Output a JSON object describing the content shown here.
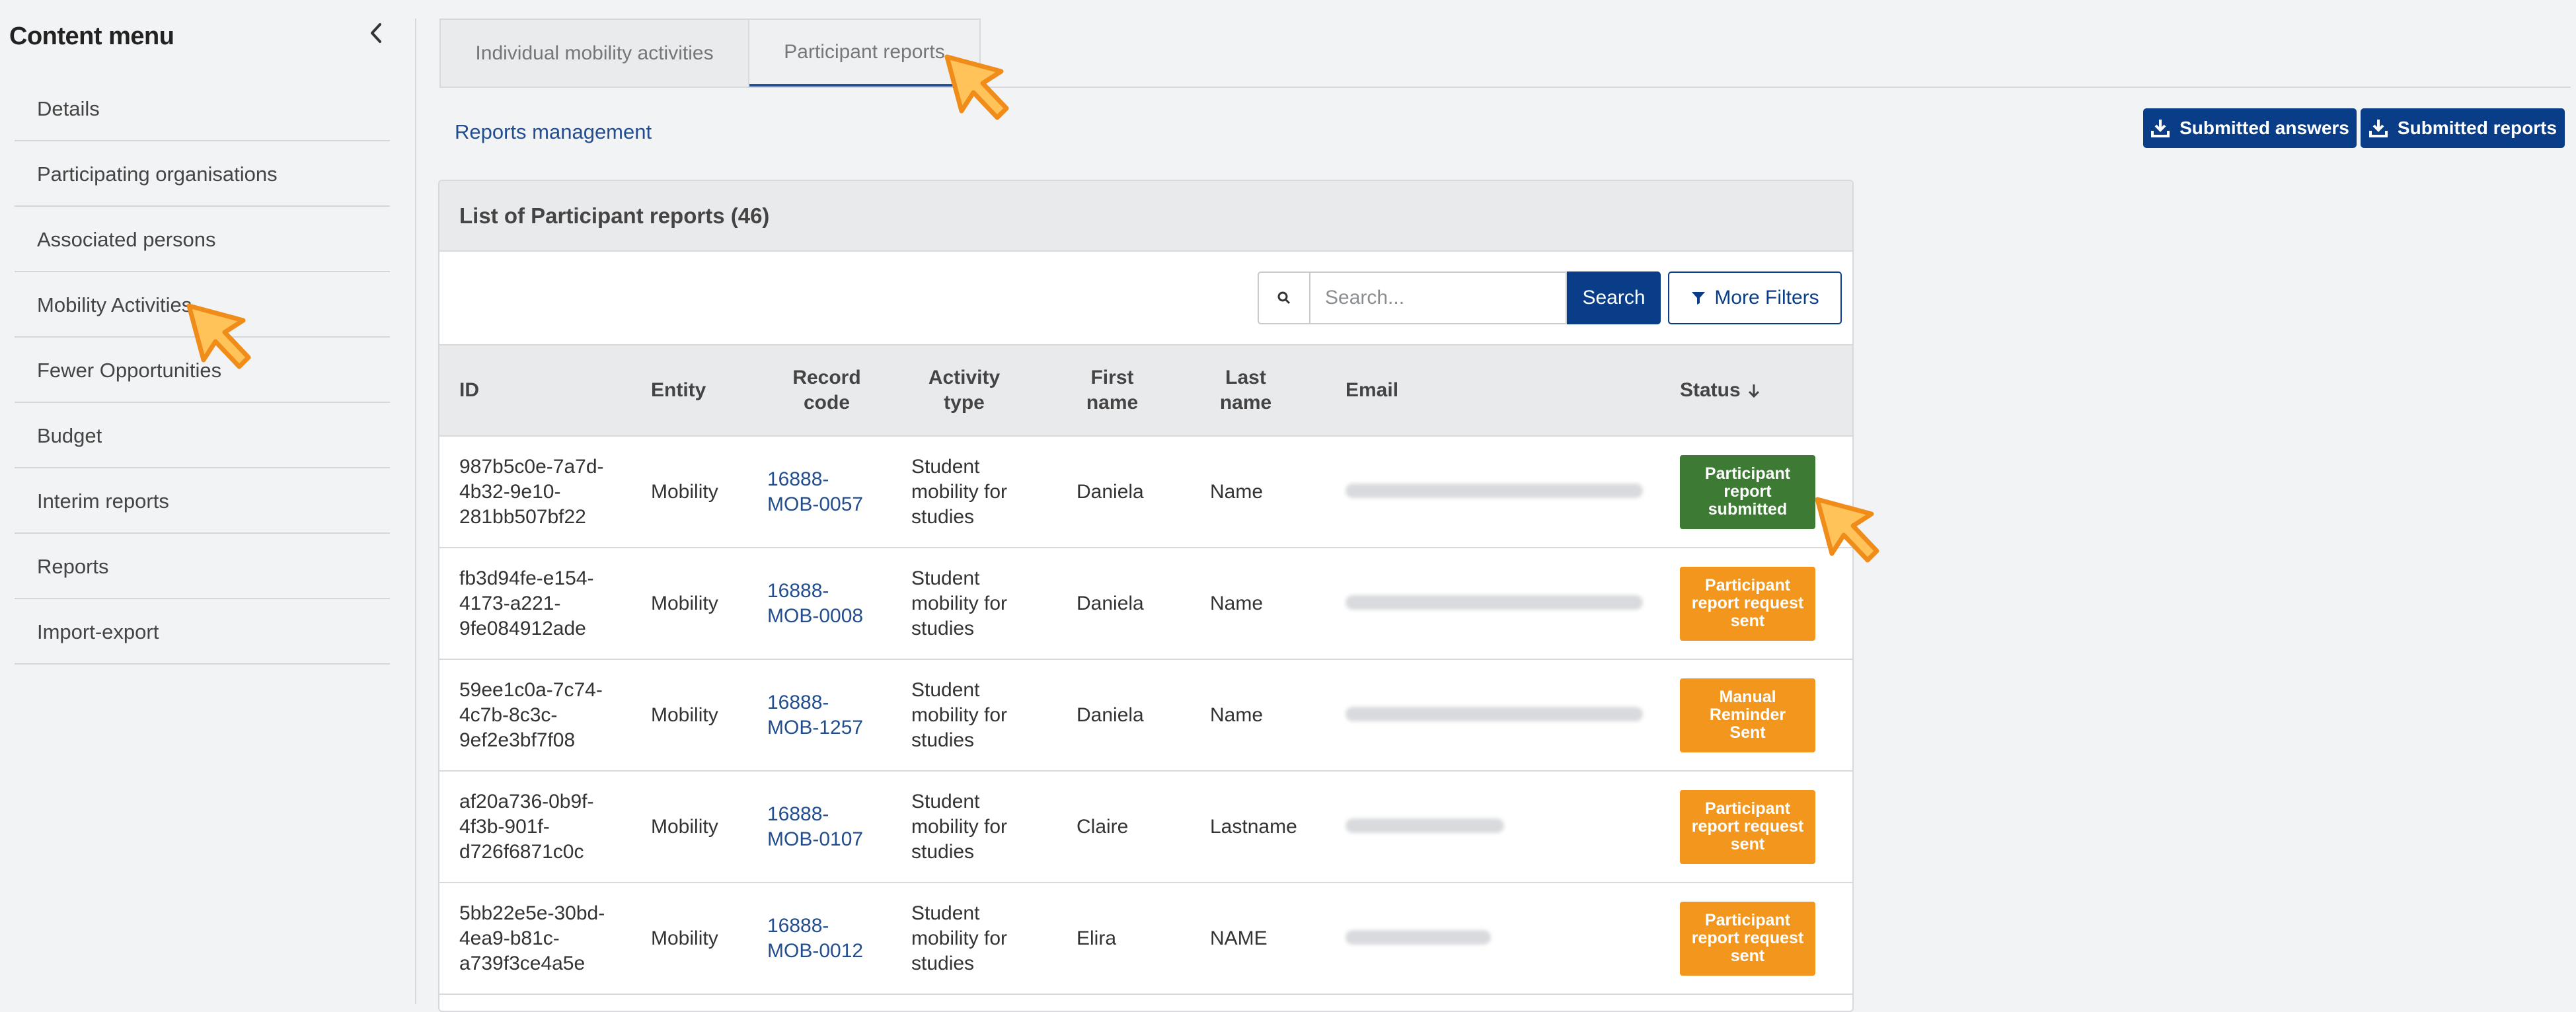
{
  "sidebar": {
    "title": "Content menu",
    "items": [
      {
        "label": "Details"
      },
      {
        "label": "Participating organisations"
      },
      {
        "label": "Associated persons"
      },
      {
        "label": "Mobility Activities"
      },
      {
        "label": "Fewer Opportunities"
      },
      {
        "label": "Budget"
      },
      {
        "label": "Interim reports"
      },
      {
        "label": "Reports"
      },
      {
        "label": "Import-export"
      }
    ]
  },
  "tabs": [
    {
      "label": "Individual mobility activities"
    },
    {
      "label": "Participant reports"
    }
  ],
  "reports_link": "Reports management",
  "buttons": {
    "submitted_answers": "Submitted answers",
    "submitted_reports": "Submitted reports"
  },
  "panel": {
    "title": "List of Participant reports (46)"
  },
  "search": {
    "placeholder": "Search...",
    "button": "Search",
    "filters": "More Filters"
  },
  "table": {
    "headers": {
      "id": "ID",
      "entity": "Entity",
      "record_code_1": "Record",
      "record_code_2": "code",
      "activity_1": "Activity",
      "activity_2": "type",
      "first_1": "First",
      "first_2": "name",
      "last_1": "Last",
      "last_2": "name",
      "email": "Email",
      "status": "Status"
    },
    "rows": [
      {
        "id": [
          "987b5c0e-7a7d-",
          "4b32-9e10-",
          "281bb507bf22"
        ],
        "entity": "Mobility",
        "record": [
          "16888-",
          "MOB-0057"
        ],
        "activity": [
          "Student",
          "mobility for",
          "studies"
        ],
        "first": "Daniela",
        "last": "Name",
        "status": [
          "Participant",
          "report",
          "submitted"
        ],
        "status_color": "#3d7a34"
      },
      {
        "id": [
          "fb3d94fe-e154-",
          "4173-a221-",
          "9fe084912ade"
        ],
        "entity": "Mobility",
        "record": [
          "16888-",
          "MOB-0008"
        ],
        "activity": [
          "Student",
          "mobility for",
          "studies"
        ],
        "first": "Daniela",
        "last": "Name",
        "status": [
          "Participant",
          "report request",
          "sent"
        ],
        "status_color": "#f2961d"
      },
      {
        "id": [
          "59ee1c0a-7c74-",
          "4c7b-8c3c-",
          "9ef2e3bf7f08"
        ],
        "entity": "Mobility",
        "record": [
          "16888-",
          "MOB-1257"
        ],
        "activity": [
          "Student",
          "mobility for",
          "studies"
        ],
        "first": "Daniela",
        "last": "Name",
        "status": [
          "Manual",
          "Reminder",
          "Sent"
        ],
        "status_color": "#f2961d"
      },
      {
        "id": [
          "af20a736-0b9f-",
          "4f3b-901f-",
          "d726f6871c0c"
        ],
        "entity": "Mobility",
        "record": [
          "16888-",
          "MOB-0107"
        ],
        "activity": [
          "Student",
          "mobility for",
          "studies"
        ],
        "first": "Claire",
        "last": "Lastname",
        "status": [
          "Participant",
          "report request",
          "sent"
        ],
        "status_color": "#f2961d"
      },
      {
        "id": [
          "5bb22e5e-30bd-",
          "4ea9-b81c-",
          "a739f3ce4a5e"
        ],
        "entity": "Mobility",
        "record": [
          "16888-",
          "MOB-0012"
        ],
        "activity": [
          "Student",
          "mobility for",
          "studies"
        ],
        "first": "Elira",
        "last": "NAME",
        "status": [
          "Participant",
          "report request",
          "sent"
        ],
        "status_color": "#f2961d"
      }
    ]
  }
}
